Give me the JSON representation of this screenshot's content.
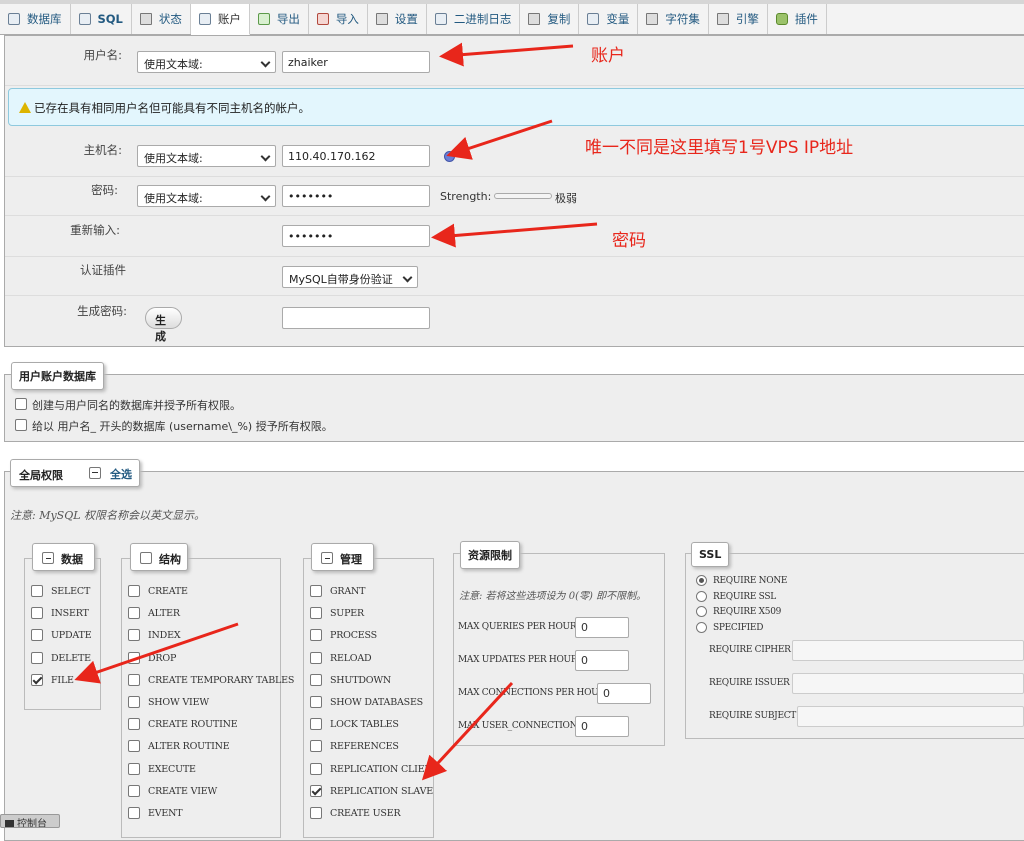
{
  "tabs": [
    {
      "label": "数据库",
      "icon": "database-icon"
    },
    {
      "label": "SQL",
      "icon": "sql-icon"
    },
    {
      "label": "状态",
      "icon": "status-icon"
    },
    {
      "label": "账户",
      "icon": "accounts-icon"
    },
    {
      "label": "导出",
      "icon": "export-icon"
    },
    {
      "label": "导入",
      "icon": "import-icon"
    },
    {
      "label": "设置",
      "icon": "wrench-icon"
    },
    {
      "label": "二进制日志",
      "icon": "binlog-icon"
    },
    {
      "label": "复制",
      "icon": "replication-icon"
    },
    {
      "label": "变量",
      "icon": "variables-icon"
    },
    {
      "label": "字符集",
      "icon": "charset-icon"
    },
    {
      "label": "引擎",
      "icon": "engine-icon"
    },
    {
      "label": "插件",
      "icon": "puzzle-icon"
    }
  ],
  "login": {
    "username_label": "用户名:",
    "username_mode": "使用文本域:",
    "username_value": "zhaiker",
    "notice": "已存在具有相同用户名但可能具有不同主机名的帐户。",
    "host_label": "主机名:",
    "host_mode": "使用文本域:",
    "host_value": "110.40.170.162",
    "password_label": "密码:",
    "password_mode": "使用文本域:",
    "password_value": "•••••••",
    "strength_label": "Strength:",
    "strength_value": "极弱",
    "retype_label": "重新输入:",
    "retype_value": "•••••••",
    "plugin_label": "认证插件",
    "plugin_value": "MySQL自带身份验证",
    "gen_label": "生成密码:",
    "gen_button": "生成"
  },
  "userdb": {
    "legend": "用户账户数据库",
    "opt1": "创建与用户同名的数据库并授予所有权限。",
    "opt2": "给以 用户名_ 开头的数据库 (username\\_%) 授予所有权限。"
  },
  "global": {
    "legend": "全局权限",
    "select_all": "全选",
    "note": "注意: MySQL 权限名称会以英文显示。",
    "data": {
      "title": "数据",
      "items": [
        {
          "label": "SELECT",
          "checked": false
        },
        {
          "label": "INSERT",
          "checked": false
        },
        {
          "label": "UPDATE",
          "checked": false
        },
        {
          "label": "DELETE",
          "checked": false
        },
        {
          "label": "FILE",
          "checked": true
        }
      ]
    },
    "structure": {
      "title": "结构",
      "items": [
        {
          "label": "CREATE",
          "checked": false
        },
        {
          "label": "ALTER",
          "checked": false
        },
        {
          "label": "INDEX",
          "checked": false
        },
        {
          "label": "DROP",
          "checked": false
        },
        {
          "label": "CREATE TEMPORARY TABLES",
          "checked": false
        },
        {
          "label": "SHOW VIEW",
          "checked": false
        },
        {
          "label": "CREATE ROUTINE",
          "checked": false
        },
        {
          "label": "ALTER ROUTINE",
          "checked": false
        },
        {
          "label": "EXECUTE",
          "checked": false
        },
        {
          "label": "CREATE VIEW",
          "checked": false
        },
        {
          "label": "EVENT",
          "checked": false
        }
      ]
    },
    "admin": {
      "title": "管理",
      "items": [
        {
          "label": "GRANT",
          "checked": false
        },
        {
          "label": "SUPER",
          "checked": false
        },
        {
          "label": "PROCESS",
          "checked": false
        },
        {
          "label": "RELOAD",
          "checked": false
        },
        {
          "label": "SHUTDOWN",
          "checked": false
        },
        {
          "label": "SHOW DATABASES",
          "checked": false
        },
        {
          "label": "LOCK TABLES",
          "checked": false
        },
        {
          "label": "REFERENCES",
          "checked": false
        },
        {
          "label": "REPLICATION CLIENT",
          "checked": false
        },
        {
          "label": "REPLICATION SLAVE",
          "checked": true
        },
        {
          "label": "CREATE USER",
          "checked": false
        }
      ]
    },
    "limits": {
      "title": "资源限制",
      "note": "注意: 若将这些选项设为 0(零) 即不限制。",
      "items": [
        {
          "label": "MAX QUERIES PER HOUR",
          "value": "0"
        },
        {
          "label": "MAX UPDATES PER HOUR",
          "value": "0"
        },
        {
          "label": "MAX CONNECTIONS PER HOUR",
          "value": "0"
        },
        {
          "label": "MAX USER_CONNECTIONS",
          "value": "0"
        }
      ]
    },
    "ssl": {
      "title": "SSL",
      "options": [
        {
          "label": "REQUIRE NONE",
          "checked": true
        },
        {
          "label": "REQUIRE SSL",
          "checked": false
        },
        {
          "label": "REQUIRE X509",
          "checked": false
        },
        {
          "label": "SPECIFIED",
          "checked": false
        }
      ],
      "fields": [
        "REQUIRE CIPHER",
        "REQUIRE ISSUER",
        "REQUIRE SUBJECT"
      ]
    }
  },
  "console": "控制台",
  "annotations": {
    "account": "账户",
    "host_note": "唯一不同是这里填写1号VPS IP地址",
    "password": "密码"
  },
  "colors": {
    "annotation": "#e8261b",
    "link": "#235a81",
    "notice_bg": "#e3f6fd"
  }
}
